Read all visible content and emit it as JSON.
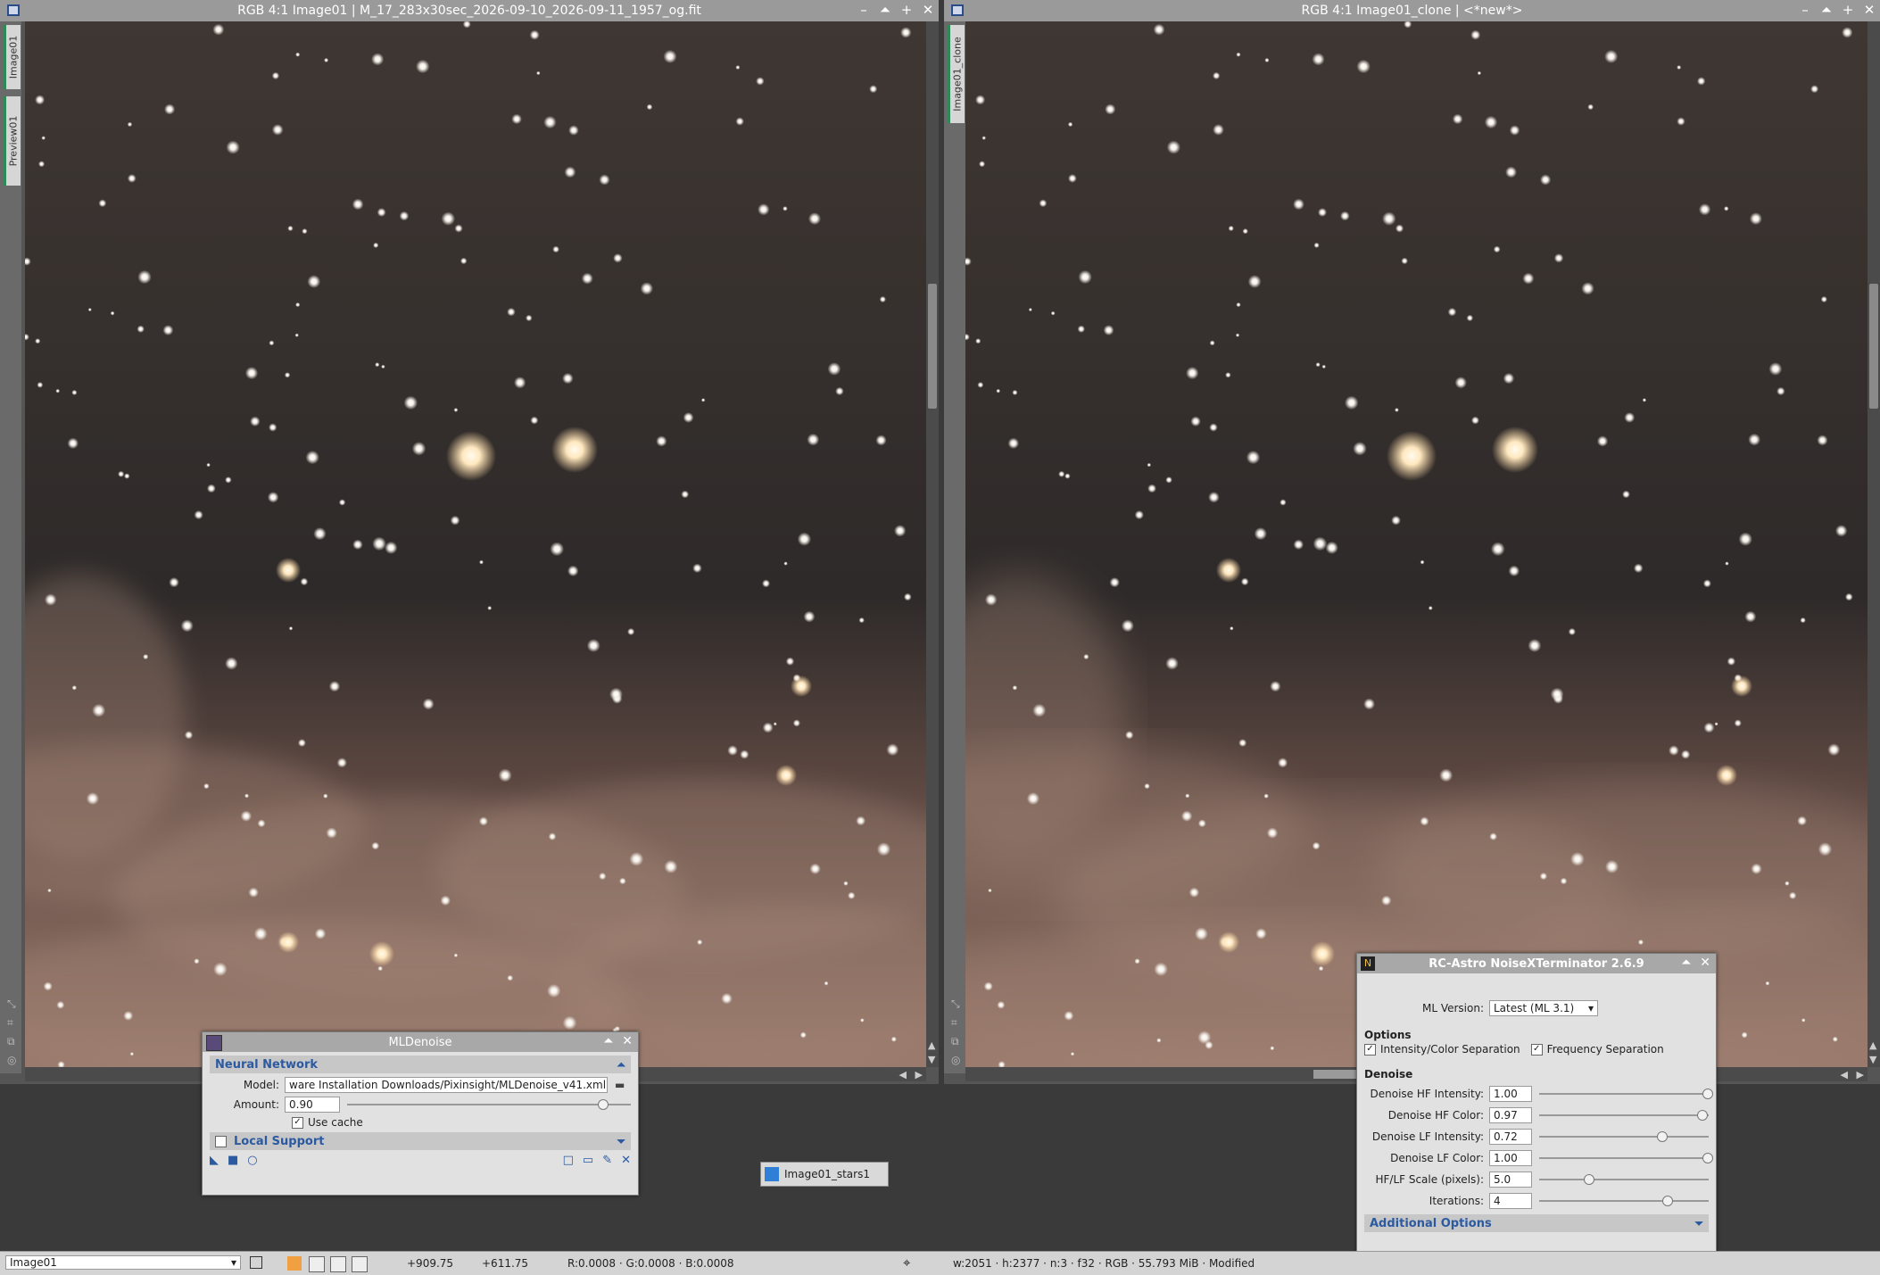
{
  "windows": {
    "left": {
      "title": "RGB 4:1 Image01 | M_17_283x30sec_2026-09-10_2026-09-11_1957_og.fit",
      "tabs": [
        "Image01",
        "Preview01"
      ]
    },
    "right": {
      "title": "RGB 4:1 Image01_clone | <*new*>",
      "tabs": [
        "Image01_clone"
      ]
    }
  },
  "mldenoise": {
    "title": "MLDenoise",
    "section_nn": "Neural Network",
    "model_label": "Model:",
    "model_value": "ware Installation Downloads/Pixinsight/MLDenoise_v41.xmlm",
    "amount_label": "Amount:",
    "amount_value": "0.90",
    "amount_fraction": 0.9,
    "use_cache_label": "Use cache",
    "use_cache_checked": true,
    "section_local": "Local Support"
  },
  "icon_label": "Image01_stars1",
  "nxt": {
    "title": "RC-Astro NoiseXTerminator 2.6.9",
    "ml_version_label": "ML Version:",
    "ml_version_value": "Latest (ML 3.1)",
    "options_heading": "Options",
    "opt_intensity": "Intensity/Color Separation",
    "opt_frequency": "Frequency Separation",
    "denoise_heading": "Denoise",
    "params": [
      {
        "label": "Denoise HF Intensity:",
        "value": "1.00",
        "fraction": 0.99
      },
      {
        "label": "Denoise HF Color:",
        "value": "0.97",
        "fraction": 0.96
      },
      {
        "label": "Denoise LF Intensity:",
        "value": "0.72",
        "fraction": 0.72
      },
      {
        "label": "Denoise LF Color:",
        "value": "1.00",
        "fraction": 0.99
      },
      {
        "label": "HF/LF Scale (pixels):",
        "value": "5.0",
        "fraction": 0.29
      },
      {
        "label": "Iterations:",
        "value": "4",
        "fraction": 0.75
      }
    ],
    "additional_options": "Additional Options"
  },
  "status": {
    "view": "Image01",
    "x": "+909.75",
    "y": "+611.75",
    "rgb": "R:0.0008 · G:0.0008 · B:0.0008",
    "info": "w:2051 · h:2377 · n:3 · f32 · RGB · 55.793 MiB · Modified"
  },
  "colors": {
    "accent": "#2c5aa0",
    "tab_green": "#2e8b57",
    "sky": "#3b3531",
    "nebula": "#8a6a5e"
  }
}
